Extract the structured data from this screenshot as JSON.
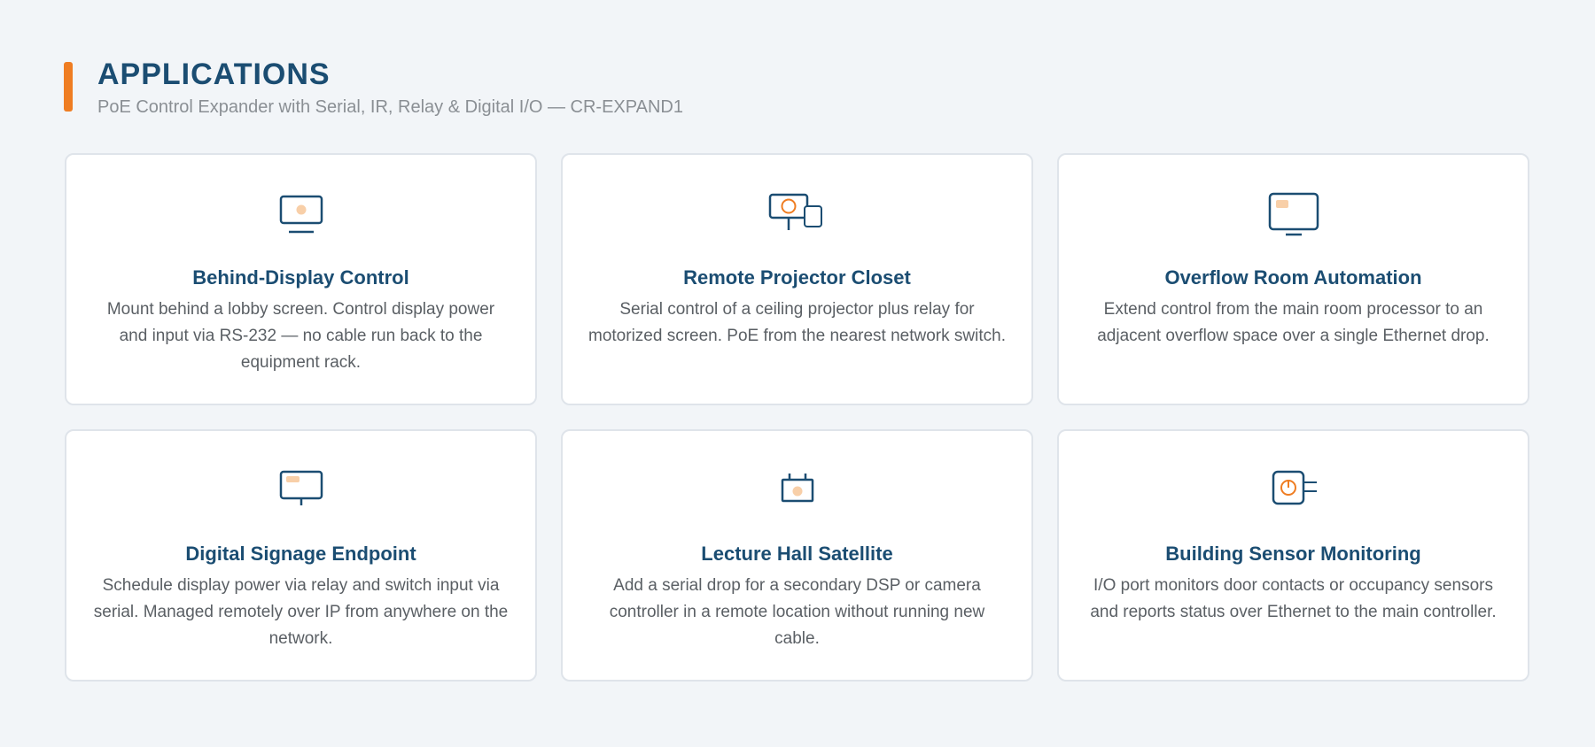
{
  "header": {
    "title": "APPLICATIONS",
    "subtitle": "PoE Control Expander with Serial, IR, Relay & Digital I/O — CR-EXPAND1"
  },
  "colors": {
    "accent": "#ef7d22",
    "primary": "#1b4d72",
    "background": "#f2f5f8",
    "card_border": "#dfe4ea",
    "text_muted": "#5a5f64"
  },
  "cards": [
    {
      "icon": "display-screen-icon",
      "title": "Behind-Display Control",
      "description": "Mount behind a lobby screen. Control display power and input via RS-232 — no cable run back to the equipment rack."
    },
    {
      "icon": "projector-icon",
      "title": "Remote Projector Closet",
      "description": "Serial control of a ceiling projector plus relay for motorized screen. PoE from the nearest network switch."
    },
    {
      "icon": "monitor-icon",
      "title": "Overflow Room Automation",
      "description": "Extend control from the main room processor to an adjacent overflow space over a single Ethernet drop."
    },
    {
      "icon": "signage-icon",
      "title": "Digital Signage Endpoint",
      "description": "Schedule display power via relay and switch input via serial. Managed remotely over IP from anywhere on the network."
    },
    {
      "icon": "calendar-icon",
      "title": "Lecture Hall Satellite",
      "description": "Add a serial drop for a secondary DSP or camera controller in a remote location without running new cable."
    },
    {
      "icon": "sensor-power-icon",
      "title": "Building Sensor Monitoring",
      "description": "I/O port monitors door contacts or occupancy sensors and reports status over Ethernet to the main controller."
    }
  ]
}
